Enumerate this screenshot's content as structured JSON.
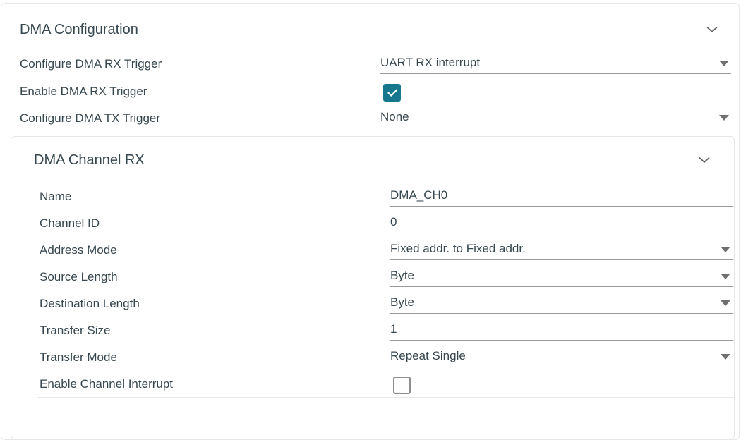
{
  "panel": {
    "title": "DMA Configuration",
    "collapse_icon": "chevron-down-icon",
    "rows": [
      {
        "label": "Configure DMA RX Trigger",
        "type": "select",
        "value": "UART RX interrupt"
      },
      {
        "label": "Enable DMA RX Trigger",
        "type": "checkbox",
        "checked": true
      },
      {
        "label": "Configure DMA TX Trigger",
        "type": "select",
        "value": "None"
      }
    ]
  },
  "subpanel": {
    "title": "DMA Channel RX",
    "collapse_icon": "chevron-down-icon",
    "rows": [
      {
        "label": "Name",
        "type": "text",
        "value": "DMA_CH0"
      },
      {
        "label": "Channel ID",
        "type": "text",
        "value": "0"
      },
      {
        "label": "Address Mode",
        "type": "select",
        "value": "Fixed addr. to Fixed addr."
      },
      {
        "label": "Source Length",
        "type": "select",
        "value": "Byte"
      },
      {
        "label": "Destination Length",
        "type": "select",
        "value": "Byte"
      },
      {
        "label": "Transfer Size",
        "type": "text",
        "value": "1"
      },
      {
        "label": "Transfer Mode",
        "type": "select",
        "value": "Repeat Single"
      },
      {
        "label": "Enable Channel Interrupt",
        "type": "checkbox",
        "checked": false
      }
    ]
  },
  "colors": {
    "accent": "#17788d",
    "text": "#37474f",
    "underline": "#9a9a9a",
    "card_border": "#e4e6e8"
  }
}
